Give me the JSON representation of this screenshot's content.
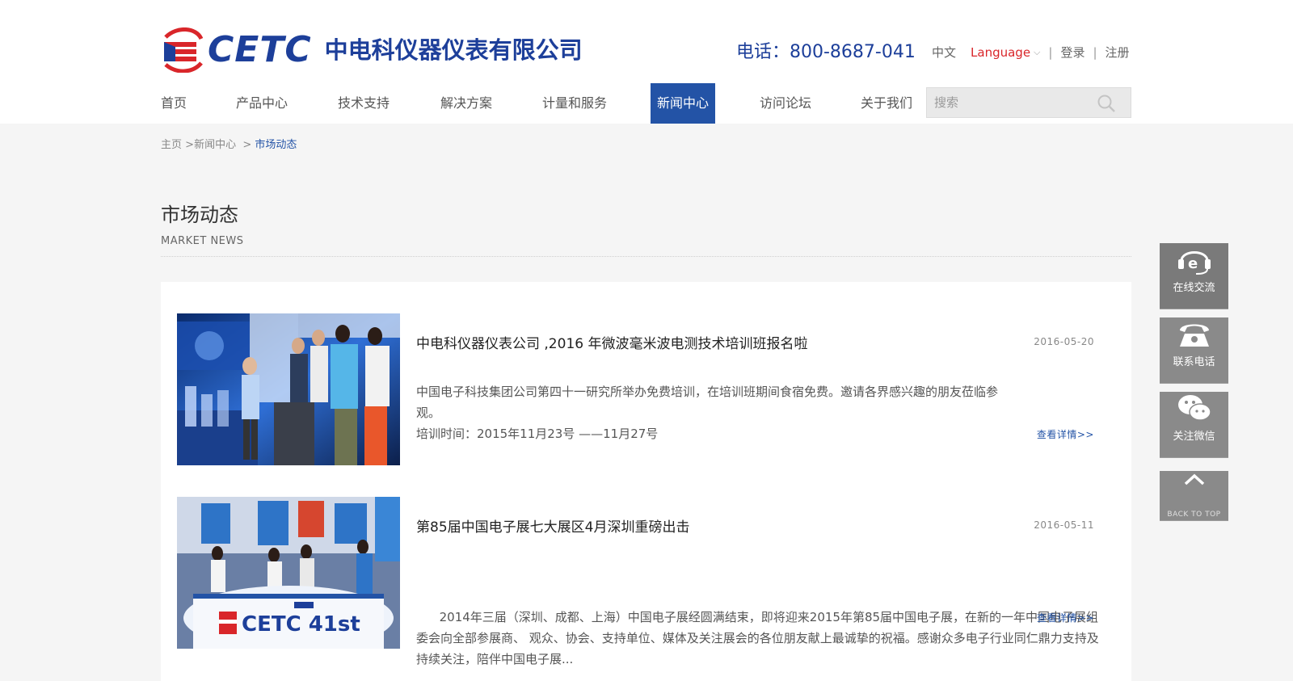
{
  "header": {
    "logo_brand": "CETC",
    "logo_company": "中电科仪器仪表有限公司",
    "phone": "电话：800-8687-041",
    "lang_cn": "中文",
    "language": "Language",
    "login": "登录",
    "register": "注册",
    "separator": "|"
  },
  "nav": {
    "items": [
      {
        "label": "首页"
      },
      {
        "label": "产品中心"
      },
      {
        "label": "技术支持"
      },
      {
        "label": "解决方案"
      },
      {
        "label": "计量和服务"
      },
      {
        "label": "新闻中心",
        "active": true
      },
      {
        "label": "访问论坛"
      },
      {
        "label": "关于我们"
      }
    ],
    "search_placeholder": "搜索"
  },
  "breadcrumb": {
    "home": "主页",
    "sep1": ">",
    "section": "新闻中心",
    "sep2": ">",
    "current": "市场动态"
  },
  "page": {
    "title": "市场动态",
    "subtitle": "MARKET NEWS"
  },
  "news": [
    {
      "title": "中电科仪器仪表公司 ,2016 年微波毫米波电测技术培训班报名啦",
      "date": "2016-05-20",
      "summary_lines": [
        " 中国电子科技集团公司第四十一研究所举办免费培训，在培训班期间食宿免费。邀请各界感兴趣的朋友莅临参观。",
        "培训时间：2015年11月23号 ——11月27号"
      ],
      "more": "查看详情>>"
    },
    {
      "title": "第85届中国电子展七大展区4月深圳重磅出击",
      "date": "2016-05-11",
      "summary_lines": [
        "      2014年三届（深圳、成都、上海）中国电子展经圆满结束，即将迎来2015年第85届中国电子展，在新的一年中国电子展组委会向全部参展商、 观众、协会、支持单位、媒体及关注展会的各位朋友献上最诚挚的祝福。感谢众多电子行业同仁鼎力支持及持续关注，陪伴中国电子展..."
      ],
      "more": "查看详情>>",
      "image_text": "CETC 41st"
    }
  ],
  "sidebar": {
    "online": "在线交流",
    "phone": "联系电话",
    "wechat": "关注微信",
    "back_top": "BACK TO TOP"
  },
  "colors": {
    "brand_blue": "#1d3f9a",
    "nav_active": "#2353a6",
    "logo_red": "#d9262a"
  }
}
